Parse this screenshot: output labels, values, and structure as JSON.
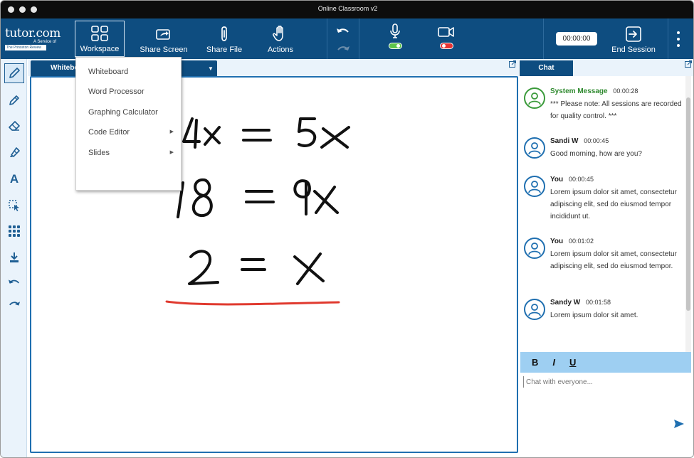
{
  "window": {
    "title": "Online Classroom v2"
  },
  "brand": {
    "name": "tutor.com",
    "sub": "A Service of",
    "partner": "The Princeton Review"
  },
  "toolbar": {
    "workspace_label": "Workspace",
    "share_screen_label": "Share Screen",
    "share_file_label": "Share File",
    "actions_label": "Actions",
    "timer": "00:00:00",
    "end_session_label": "End Session",
    "mic_on": true,
    "camera_on": false,
    "colors": {
      "bar": "#0e4d80",
      "mic_status": "#5cc54a",
      "camera_status": "#e53333"
    }
  },
  "workspace_menu": [
    {
      "label": "Whiteboard",
      "submenu": false
    },
    {
      "label": "Word Processor",
      "submenu": false
    },
    {
      "label": "Graphing Calculator",
      "submenu": false
    },
    {
      "label": "Code Editor",
      "submenu": true
    },
    {
      "label": "Slides",
      "submenu": true
    }
  ],
  "workspace_tab": {
    "label": "Whiteboard"
  },
  "tools": [
    "pencil-icon",
    "pen-icon",
    "eraser-icon",
    "highlighter-icon",
    "text-icon",
    "select-icon",
    "grid-icon",
    "download-icon",
    "undo-icon",
    "redo-icon"
  ],
  "whiteboard": {
    "lines": [
      "4x = 5x",
      "18 = 9x",
      "2 = x"
    ],
    "underline_color": "#e03a2f"
  },
  "chat": {
    "tab_label": "Chat",
    "messages": [
      {
        "sender": "System Message",
        "time": "00:00:28",
        "system": true,
        "text": "*** Please note: All sessions are recorded for quality control. ***"
      },
      {
        "sender": "Sandi W",
        "time": "00:00:45",
        "system": false,
        "text": "Good morning, how are you?"
      },
      {
        "sender": "You",
        "time": "00:00:45",
        "system": false,
        "text": "Lorem ipsum dolor sit amet, consectetur adipiscing elit, sed do eiusmod tempor incididunt ut."
      },
      {
        "sender": "You",
        "time": "00:01:02",
        "system": false,
        "text": "Lorem ipsum dolor sit amet, consectetur adipiscing elit, sed do eiusmod tempor."
      },
      {
        "sender": "Sandy W",
        "time": "00:01:58",
        "system": false,
        "text": "Lorem ipsum dolor sit amet."
      }
    ],
    "format": {
      "bold": "B",
      "italic": "I",
      "underline": "U"
    },
    "input_placeholder": "Chat with everyone..."
  }
}
